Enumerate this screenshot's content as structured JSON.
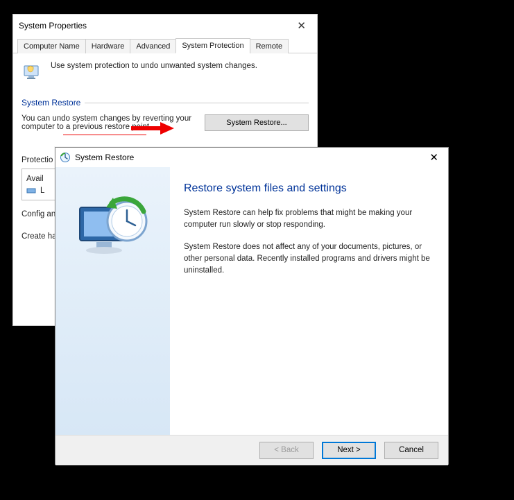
{
  "propwin": {
    "title": "System Properties",
    "tabs": [
      "Computer Name",
      "Hardware",
      "Advanced",
      "System Protection",
      "Remote"
    ],
    "active_tab_index": 3,
    "intro": "Use system protection to undo unwanted system changes.",
    "section_restore_label": "System Restore",
    "restore_desc": "You can undo system changes by reverting your computer to a previous restore point.",
    "restore_button": "System Restore...",
    "protection_label_truncated": "Protectio",
    "avail_truncated": "Avail",
    "drive_truncated": "L",
    "configure_truncated": "Config\nand de",
    "create_truncated": "Create\nhave s"
  },
  "wizard": {
    "title": "System Restore",
    "heading": "Restore system files and settings",
    "p1": "System Restore can help fix problems that might be making your computer run slowly or stop responding.",
    "p2": "System Restore does not affect any of your documents, pictures, or other personal data. Recently installed programs and drivers might be uninstalled.",
    "back": "< Back",
    "next": "Next >",
    "cancel": "Cancel"
  }
}
